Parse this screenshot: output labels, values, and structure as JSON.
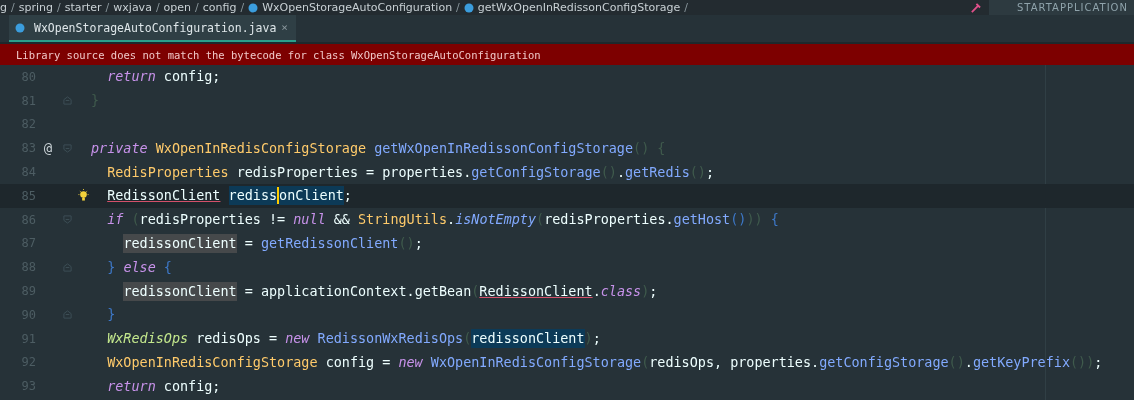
{
  "breadcrumb": {
    "items": [
      {
        "text": "g",
        "icon": false
      },
      {
        "text": "spring",
        "icon": false
      },
      {
        "text": "starter",
        "icon": false
      },
      {
        "text": "wxjava",
        "icon": false
      },
      {
        "text": "open",
        "icon": false
      },
      {
        "text": "config",
        "icon": false
      },
      {
        "text": "WxOpenStorageAutoConfiguration",
        "icon": true
      },
      {
        "text": "getWxOpenInRedissonConfigStorage",
        "icon": true
      }
    ],
    "separator": "/"
  },
  "run_config": {
    "label": "STARTAPPLICATION"
  },
  "tabs": [
    {
      "label": "WxOpenStorageAutoConfiguration.java",
      "close": "×",
      "selected": true
    }
  ],
  "banner": {
    "text": "Library source does not match the bytecode for class WxOpenStorageAutoConfiguration"
  },
  "editor": {
    "lines": [
      {
        "number": "80",
        "current": false,
        "fold_start": false,
        "fold_end": false,
        "bulb": false,
        "tokens": [
          {
            "text": "  return",
            "kind": "keyword"
          },
          {
            "text": " config;",
            "kind": "plain"
          }
        ]
      },
      {
        "number": "81",
        "current": false,
        "fold_start": false,
        "fold_end": true,
        "bulb": false,
        "tokens": [
          {
            "text": "}",
            "kind": "paren"
          }
        ]
      },
      {
        "number": "82",
        "current": false,
        "fold_start": false,
        "fold_end": false,
        "bulb": false
      },
      {
        "number": "83",
        "current": false,
        "fold_start": true,
        "fold_end": false,
        "bulb": false,
        "mark": "@",
        "tokens": [
          {
            "text": "private",
            "kind": "keyword"
          },
          {
            "text": " WxOpenInRedisConfigStorage",
            "kind": "type"
          },
          {
            "text": " getWxOpenInRedissonConfigStorage",
            "kind": "method"
          },
          {
            "text": "() {",
            "kind": "paren"
          }
        ]
      },
      {
        "number": "84",
        "current": false,
        "fold_start": false,
        "fold_end": false,
        "bulb": false,
        "tokens": [
          {
            "text": "  RedisProperties",
            "kind": "type"
          },
          {
            "text": " redisProperties = properties.",
            "kind": "plain"
          },
          {
            "text": "getConfigStorage",
            "kind": "method"
          },
          {
            "text": "()",
            "kind": "paren"
          },
          {
            "text": ".",
            "kind": "plain"
          },
          {
            "text": "getRedis",
            "kind": "method"
          },
          {
            "text": "()",
            "kind": "paren"
          },
          {
            "text": ";",
            "kind": "plain"
          }
        ]
      },
      {
        "number": "85",
        "current": true,
        "fold_start": false,
        "fold_end": false,
        "bulb": true,
        "tokens": [
          {
            "text": "  RedissonClient",
            "kind": "unresolved"
          },
          {
            "text": " rediss",
            "kind": "selected",
            "caret_after": true
          },
          {
            "text": "onClient",
            "kind": "selected"
          },
          {
            "text": ";",
            "kind": "plain"
          }
        ]
      },
      {
        "number": "86",
        "current": false,
        "fold_start": true,
        "fold_end": false,
        "bulb": false,
        "tokens": [
          {
            "text": "  if",
            "kind": "keyword"
          },
          {
            "text": " (",
            "kind": "paren"
          },
          {
            "text": "redisProperties != ",
            "kind": "plain"
          },
          {
            "text": "null",
            "kind": "literal"
          },
          {
            "text": " && ",
            "kind": "plain"
          },
          {
            "text": "StringUtils",
            "kind": "type"
          },
          {
            "text": ".",
            "kind": "plain"
          },
          {
            "text": "isNotEmpty",
            "kind": "static"
          },
          {
            "text": "(",
            "kind": "paren"
          },
          {
            "text": "redisProperties.",
            "kind": "plain"
          },
          {
            "text": "getHost",
            "kind": "method"
          },
          {
            "text": "()",
            "kind": "brace"
          },
          {
            "text": ")) ",
            "kind": "paren"
          },
          {
            "text": "{",
            "kind": "brace"
          }
        ]
      },
      {
        "number": "87",
        "current": false,
        "fold_start": false,
        "fold_end": false,
        "bulb": false,
        "tokens": [
          {
            "text": "    redissonClient",
            "kind": "usage"
          },
          {
            "text": " = ",
            "kind": "plain"
          },
          {
            "text": "getRedissonClient",
            "kind": "method"
          },
          {
            "text": "()",
            "kind": "paren"
          },
          {
            "text": ";",
            "kind": "plain"
          }
        ]
      },
      {
        "number": "88",
        "current": false,
        "fold_start": false,
        "fold_end": true,
        "bulb": false,
        "tokens": [
          {
            "text": "  }",
            "kind": "brace"
          },
          {
            "text": " else",
            "kind": "keyword"
          },
          {
            "text": " {",
            "kind": "brace"
          }
        ]
      },
      {
        "number": "89",
        "current": false,
        "fold_start": false,
        "fold_end": false,
        "bulb": false,
        "tokens": [
          {
            "text": "    redissonClient",
            "kind": "usage"
          },
          {
            "text": " = applicationContext.getBean",
            "kind": "plain"
          },
          {
            "text": "(",
            "kind": "paren"
          },
          {
            "text": "RedissonClient",
            "kind": "unresolved"
          },
          {
            "text": ".",
            "kind": "plain"
          },
          {
            "text": "class",
            "kind": "keyword"
          },
          {
            "text": ")",
            "kind": "paren"
          },
          {
            "text": ";",
            "kind": "plain"
          }
        ]
      },
      {
        "number": "90",
        "current": false,
        "fold_start": false,
        "fold_end": true,
        "bulb": false,
        "tokens": [
          {
            "text": "  }",
            "kind": "brace"
          }
        ]
      },
      {
        "number": "91",
        "current": false,
        "fold_start": false,
        "fold_end": false,
        "bulb": false,
        "tokens": [
          {
            "text": "  WxRedisOps",
            "kind": "interface"
          },
          {
            "text": " redisOps = ",
            "kind": "plain"
          },
          {
            "text": "new",
            "kind": "keyword"
          },
          {
            "text": " RedissonWxRedisOps",
            "kind": "method"
          },
          {
            "text": "(",
            "kind": "paren"
          },
          {
            "text": "redissonClient",
            "kind": "selected"
          },
          {
            "text": ")",
            "kind": "paren"
          },
          {
            "text": ";",
            "kind": "plain"
          }
        ]
      },
      {
        "number": "92",
        "current": false,
        "fold_start": false,
        "fold_end": false,
        "bulb": false,
        "tokens": [
          {
            "text": "  WxOpenInRedisConfigStorage",
            "kind": "type"
          },
          {
            "text": " config = ",
            "kind": "plain"
          },
          {
            "text": "new",
            "kind": "keyword"
          },
          {
            "text": " WxOpenInRedisConfigStorage",
            "kind": "method"
          },
          {
            "text": "(",
            "kind": "paren"
          },
          {
            "text": "redisOps, properties.",
            "kind": "plain"
          },
          {
            "text": "getConfigStorage",
            "kind": "method"
          },
          {
            "text": "()",
            "kind": "paren"
          },
          {
            "text": ".",
            "kind": "plain"
          },
          {
            "text": "getKeyPrefix",
            "kind": "method"
          },
          {
            "text": "())",
            "kind": "paren"
          },
          {
            "text": ";",
            "kind": "plain"
          }
        ]
      },
      {
        "number": "93",
        "current": false,
        "fold_start": false,
        "fold_end": false,
        "bulb": false,
        "tokens": [
          {
            "text": "  return",
            "kind": "keyword"
          },
          {
            "text": " config;",
            "kind": "plain"
          }
        ]
      }
    ]
  }
}
